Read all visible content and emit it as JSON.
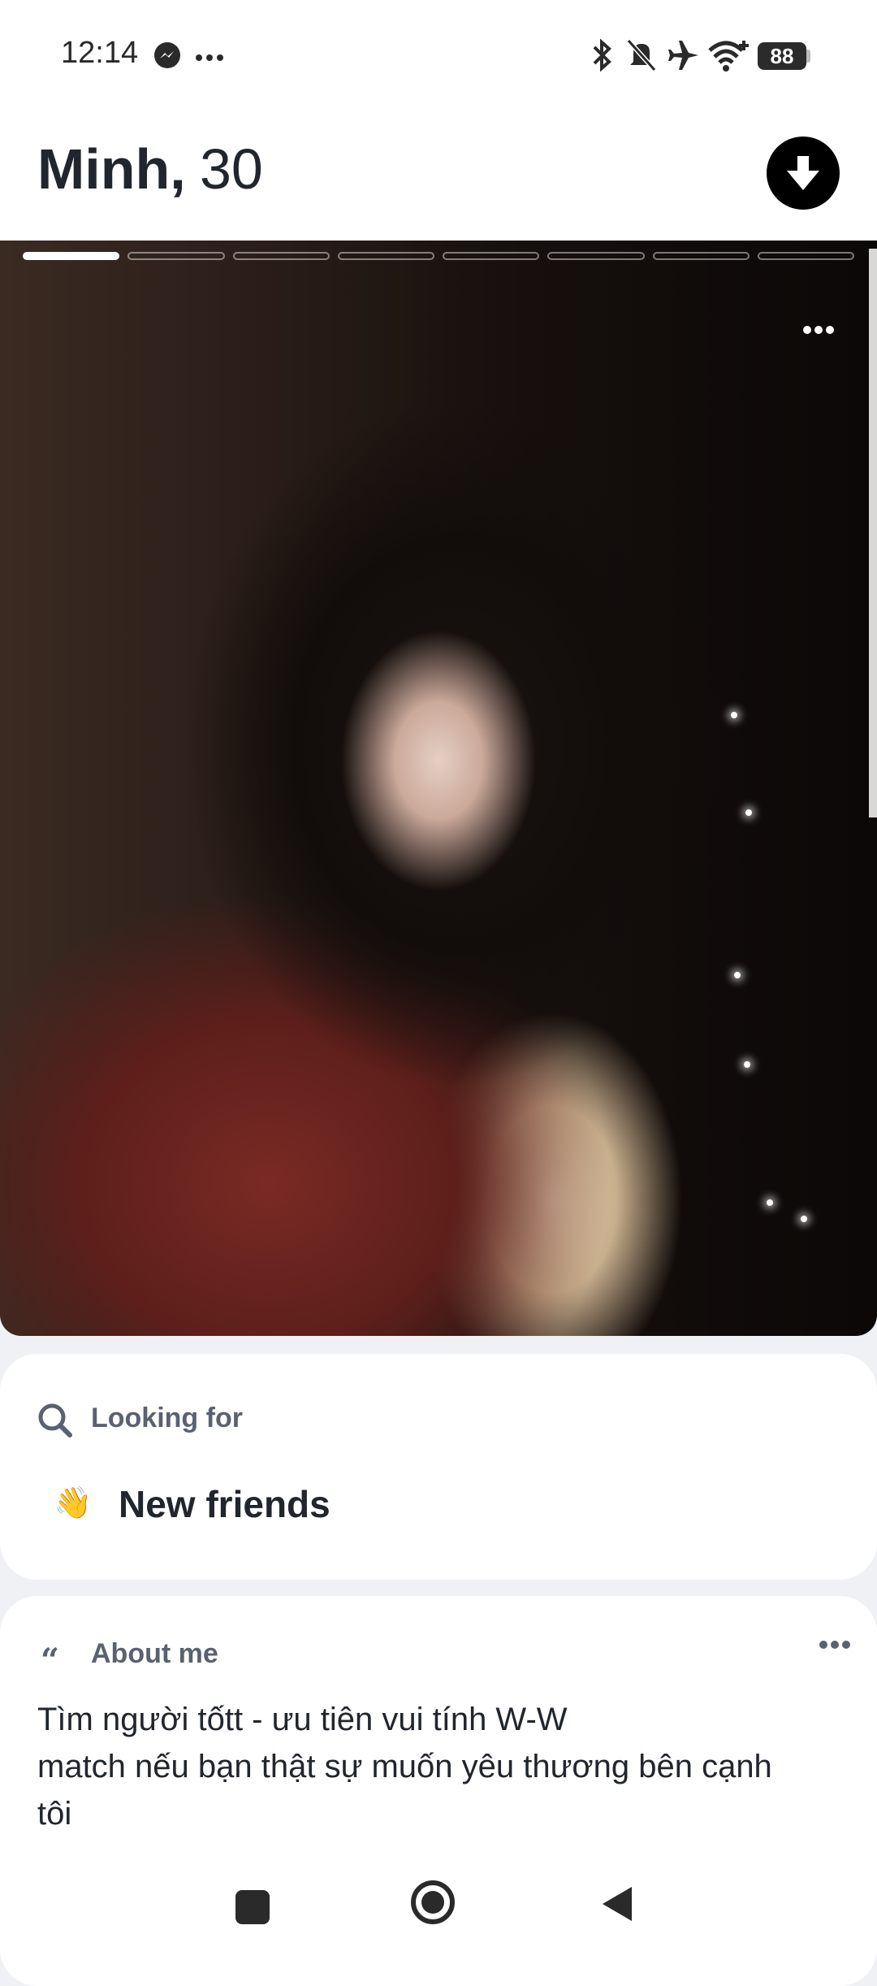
{
  "status_bar": {
    "time": "12:14",
    "battery": "88",
    "icons": [
      "messenger-icon",
      "more-dots-icon",
      "bluetooth-icon",
      "mute-icon",
      "airplane-icon",
      "wifi-icon",
      "battery-icon"
    ]
  },
  "profile": {
    "name": "Minh,",
    "age": "30",
    "photo_count": 8,
    "active_photo_index": 0
  },
  "looking_for": {
    "label": "Looking for",
    "emoji": "👋",
    "value": "New friends"
  },
  "about": {
    "label": "About me",
    "lines": [
      "Tìm người tốtt - ưu tiên vui tính W-W",
      "match nếu bạn thật sự muốn yêu thương bên cạnh",
      "tôi"
    ]
  },
  "colors": {
    "text_dark": "#21262e",
    "label_gray": "#5a6170",
    "background": "#f0f1f4",
    "button_black": "#000000"
  }
}
